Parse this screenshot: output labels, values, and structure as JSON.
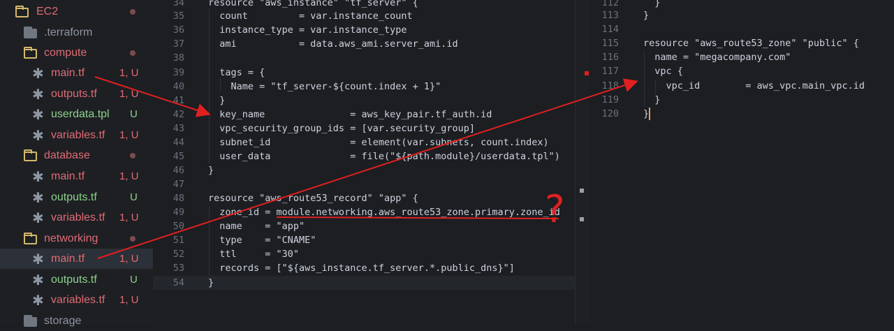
{
  "sidebar": {
    "root": {
      "label": "EC2"
    },
    "items": [
      {
        "label": ".terraform",
        "status": ""
      },
      {
        "label": "compute",
        "status": ""
      },
      {
        "label": "main.tf",
        "status": "1, U"
      },
      {
        "label": "outputs.tf",
        "status": "1, U"
      },
      {
        "label": "userdata.tpl",
        "status": "U"
      },
      {
        "label": "variables.tf",
        "status": "1, U"
      },
      {
        "label": "database",
        "status": ""
      },
      {
        "label": "main.tf",
        "status": "1, U"
      },
      {
        "label": "outputs.tf",
        "status": "U"
      },
      {
        "label": "variables.tf",
        "status": "1, U"
      },
      {
        "label": "networking",
        "status": ""
      },
      {
        "label": "main.tf",
        "status": "1, U"
      },
      {
        "label": "outputs.tf",
        "status": "U"
      },
      {
        "label": "variables.tf",
        "status": "1, U"
      },
      {
        "label": "storage",
        "status": ""
      }
    ]
  },
  "editor_left": {
    "line_numbers": [
      "34",
      "35",
      "36",
      "37",
      "38",
      "39",
      "40",
      "41",
      "42",
      "43",
      "44",
      "45",
      "46",
      "47",
      "48",
      "49",
      "50",
      "51",
      "52",
      "53",
      "54"
    ],
    "lines": [
      "resource \"aws_instance\" \"tf_server\" {",
      "  count         = var.instance_count",
      "  instance_type = var.instance_type",
      "  ami           = data.aws_ami.server_ami.id",
      "",
      "  tags = {",
      "    Name = \"tf_server-${count.index + 1}\"",
      "  }",
      "  key_name               = aws_key_pair.tf_auth.id",
      "  vpc_security_group_ids = [var.security_group]",
      "  subnet_id              = element(var.subnets, count.index)",
      "  user_data              = file(\"${path.module}/userdata.tpl\")",
      "}",
      "",
      "resource \"aws_route53_record\" \"app\" {",
      "  zone_id = module.networking.aws_route53_zone.primary.zone_id",
      "  name    = \"app\"",
      "  type    = \"CNAME\"",
      "  ttl     = \"30\"",
      "  records = [\"${aws_instance.tf_server.*.public_dns}\"]",
      "}"
    ]
  },
  "editor_right": {
    "line_numbers": [
      "112",
      "113",
      "114",
      "115",
      "116",
      "117",
      "118",
      "119",
      "120"
    ],
    "lines": [
      "  }",
      "}",
      "",
      "resource \"aws_route53_zone\" \"public\" {",
      "  name = \"megacompany.com\"",
      "  vpc {",
      "    vpc_id        = aws_vpc.main_vpc.id",
      "  }",
      "}"
    ]
  },
  "annotation": {
    "mark": "?"
  },
  "colors": {
    "background": "#1c1e22",
    "accent_red": "#e02020",
    "modified_red": "#e06c75",
    "untracked_green": "#8fd18c",
    "keyword_yellow": "#e6c75a"
  }
}
